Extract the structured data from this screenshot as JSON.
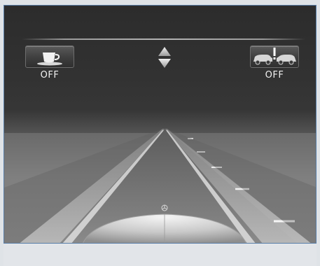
{
  "attention_assist": {
    "icon": "coffee-cup-icon",
    "status": "OFF"
  },
  "distance_warning": {
    "icon": "car-collision-warning-icon",
    "status": "OFF"
  },
  "selector": {
    "icon": "up-down-arrows-icon"
  },
  "vehicle": {
    "emblem_icon": "star-emblem-icon"
  },
  "colors": {
    "background": "#2a2a2a",
    "road": "#7a7a7a",
    "label_text": "#f2f2f2",
    "frame_border": "#5a7fa8"
  }
}
